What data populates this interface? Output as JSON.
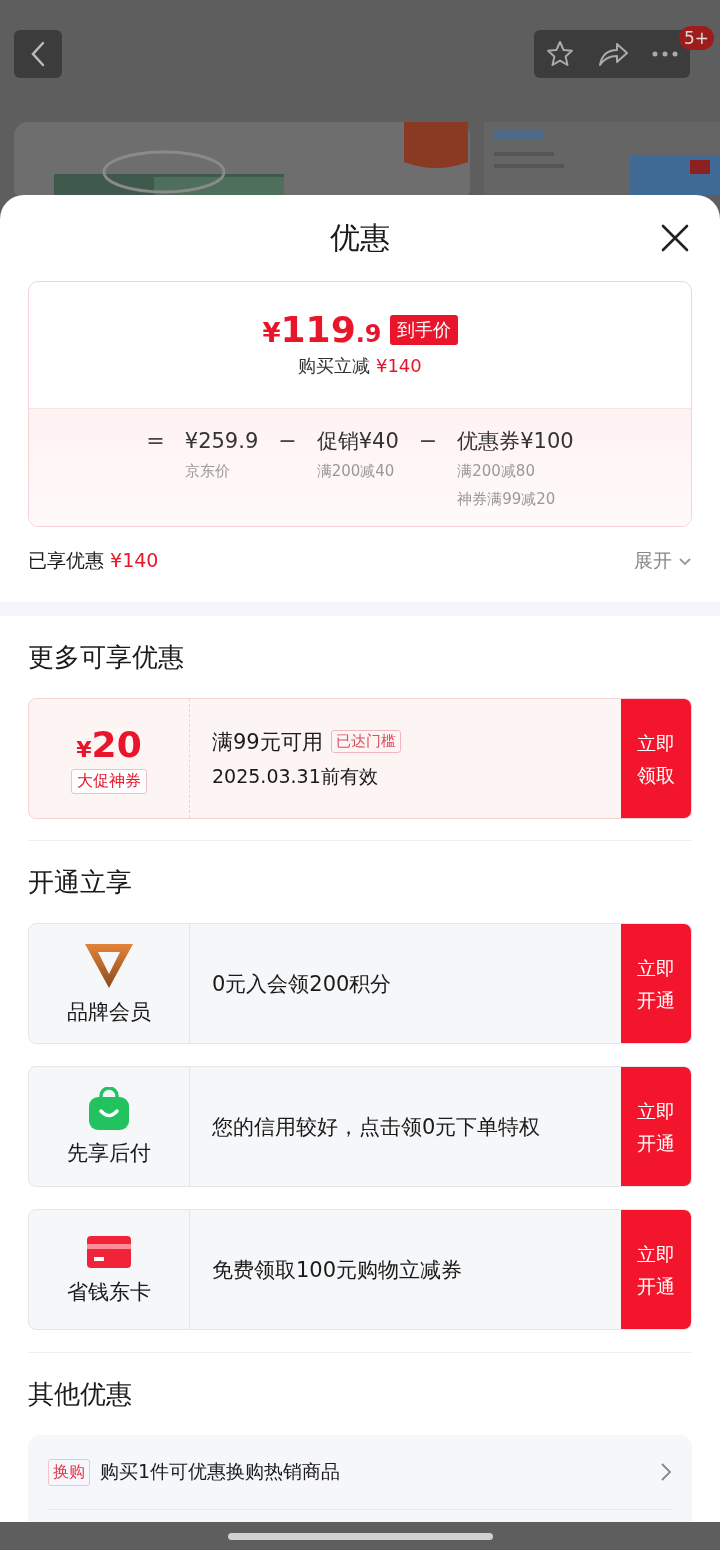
{
  "header": {
    "badge": "5+"
  },
  "sheet": {
    "title": "优惠"
  },
  "price_summary": {
    "currency": "¥",
    "price_int": "119",
    "price_dec": ".9",
    "tag": "到手价",
    "saving_label": "购买立减",
    "saving_amount": "¥140",
    "breakdown": [
      {
        "operator": "=",
        "amount": "¥259.9",
        "notes": [
          "京东价"
        ]
      },
      {
        "operator": "−",
        "label": "促销",
        "amount": "¥40",
        "notes": [
          "满200减40"
        ]
      },
      {
        "operator": "−",
        "label": "优惠券",
        "amount": "¥100",
        "notes": [
          "满200减80",
          "神券满99减20"
        ]
      }
    ]
  },
  "enjoyed": {
    "label": "已享优惠",
    "amount": "¥140",
    "toggle": "展开"
  },
  "more_offers": {
    "title": "更多可享优惠",
    "coupons": [
      {
        "currency": "¥",
        "amount": "20",
        "tag": "大促神券",
        "condition": "满99元可用",
        "badge": "已达门槛",
        "validity": "2025.03.31前有效",
        "button": "立即领取"
      }
    ]
  },
  "open_benefits": {
    "title": "开通立享",
    "items": [
      {
        "kind": "v-logo",
        "name": "品牌会员",
        "text": "0元入会领200积分",
        "button": "立即开通"
      },
      {
        "kind": "bag",
        "name": "先享后付",
        "text": "您的信用较好，点击领0元下单特权",
        "button": "立即开通"
      },
      {
        "kind": "card",
        "name": "省钱东卡",
        "text": "免费领取100元购物立减券",
        "button": "立即开通"
      }
    ]
  },
  "other_offers": {
    "title": "其他优惠",
    "items": [
      {
        "tag": "换购",
        "text": "购买1件可优惠换购热销商品"
      }
    ]
  }
}
